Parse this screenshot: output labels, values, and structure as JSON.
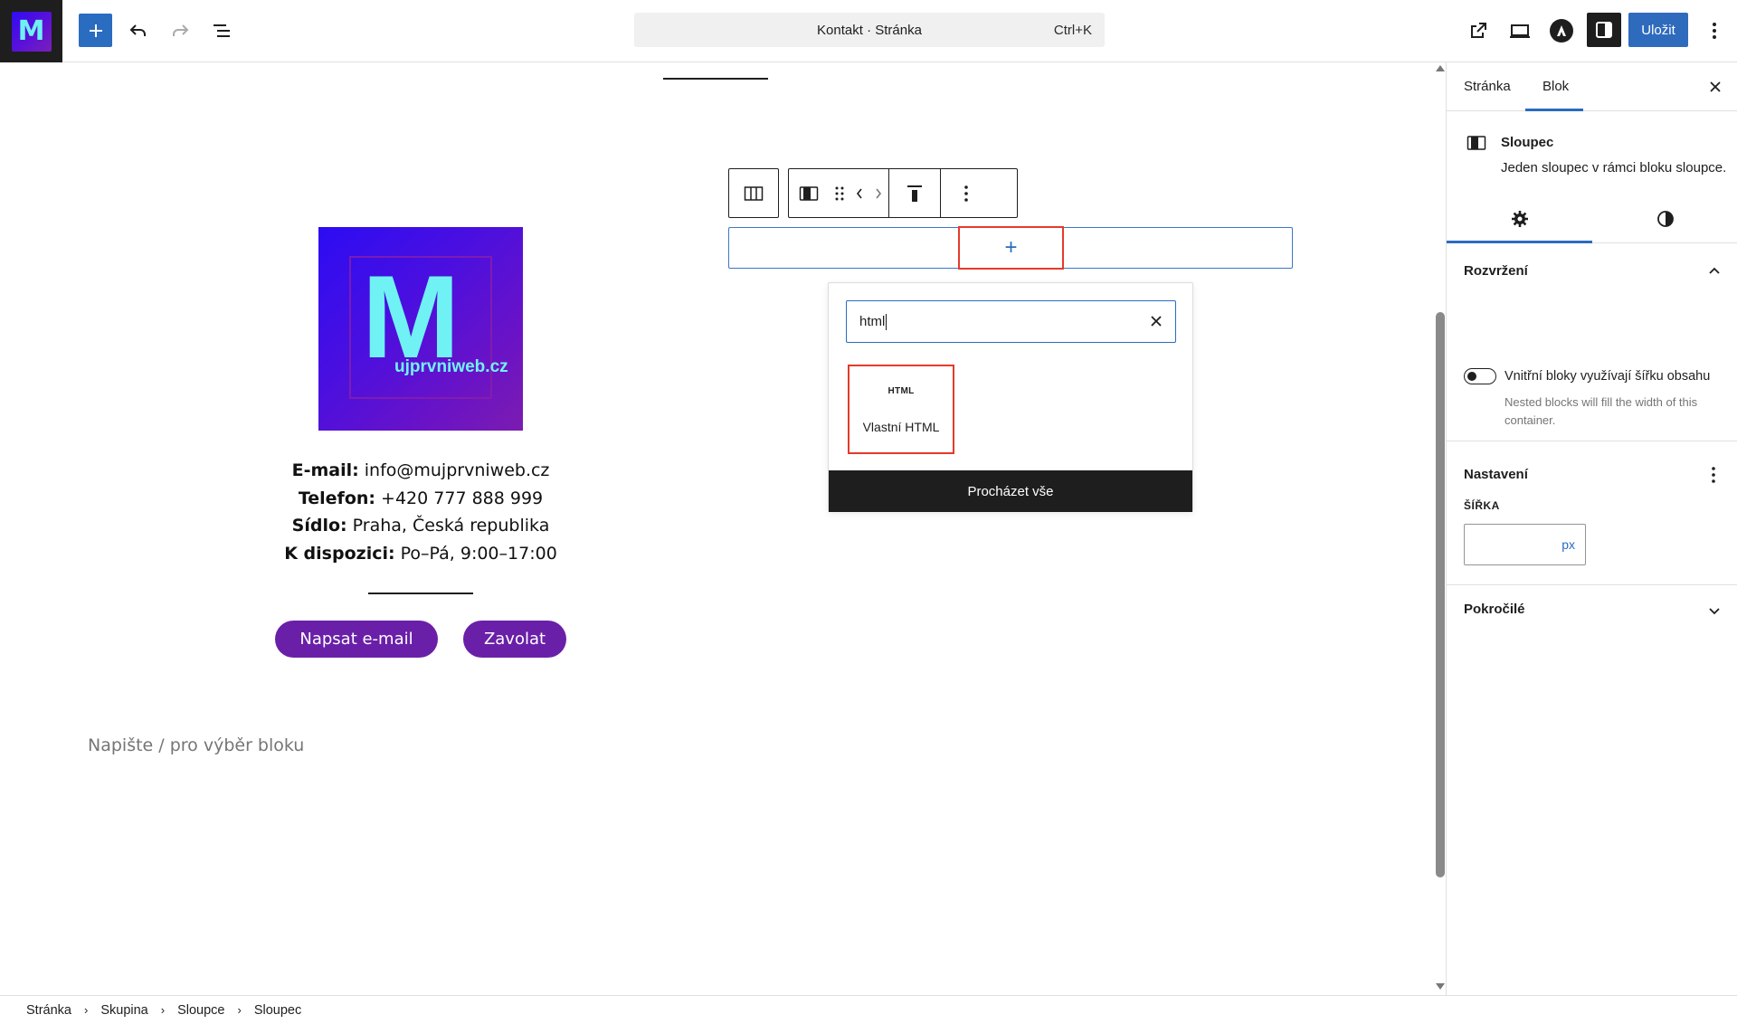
{
  "topbar": {
    "site_logo_letter": "M",
    "add_block_label": "+",
    "document_title": "Kontakt · Stránka",
    "shortcut": "Ctrl+K",
    "save_label": "Uložit",
    "accent_color": "#2a6cbf"
  },
  "canvas": {
    "logo_letter": "M",
    "logo_wordmark": "ujprvniweb.cz",
    "contact": [
      {
        "label": "E-mail:",
        "value": "info@mujprvniweb.cz"
      },
      {
        "label": "Telefon:",
        "value": "+420 777 888 999"
      },
      {
        "label": "Sídlo:",
        "value": "Praha, Česká republika"
      },
      {
        "label": "K dispozici:",
        "value": "Po–Pá, 9:00–17:00"
      }
    ],
    "buttons": {
      "email": "Napsat e-mail",
      "call": "Zavolat"
    },
    "placeholder": "Napište / pro výběr bloku",
    "appender_label": "+",
    "button_color": "#6a1fa8"
  },
  "inserter": {
    "search_value": "html",
    "result_icon_text": "HTML",
    "result_label": "Vlastní HTML",
    "browse_all": "Procházet vše"
  },
  "sidebar": {
    "tabs": [
      "Stránka",
      "Blok"
    ],
    "active_tab": "Blok",
    "block_title": "Sloupec",
    "block_description": "Jeden sloupec v rámci bloku sloupce.",
    "panel_layout": "Rozvržení",
    "toggle_label": "Vnitřní bloky využívají šířku obsahu",
    "toggle_help": "Nested blocks will fill the width of this container.",
    "panel_settings": "Nastavení",
    "width_label": "ŠÍŘKA",
    "width_unit": "px",
    "width_value": "",
    "panel_advanced": "Pokročilé"
  },
  "footer": {
    "breadcrumbs": [
      "Stránka",
      "Skupina",
      "Sloupce",
      "Sloupec"
    ]
  }
}
